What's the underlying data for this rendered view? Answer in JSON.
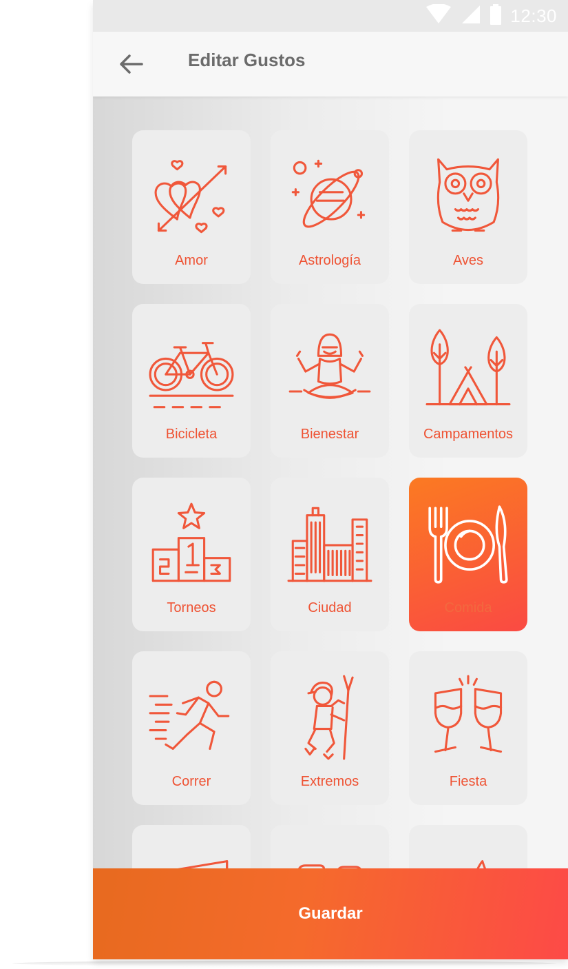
{
  "status_bar": {
    "time": "12:30",
    "icons": [
      "wifi-icon",
      "signal-icon",
      "battery-icon"
    ]
  },
  "header": {
    "title": "Editar Gustos",
    "back_icon": "arrow-left-icon"
  },
  "colors": {
    "accent": "#f0573a",
    "accent_gradient_start": "#fb7a22",
    "accent_gradient_end": "#fa4a43",
    "card_bg": "#ededed"
  },
  "interests": [
    {
      "label": "Amor",
      "icon": "hearts-arrow-icon",
      "selected": false
    },
    {
      "label": "Astrología",
      "icon": "planet-icon",
      "selected": false
    },
    {
      "label": "Aves",
      "icon": "owl-icon",
      "selected": false
    },
    {
      "label": "Bicicleta",
      "icon": "bicycle-icon",
      "selected": false
    },
    {
      "label": "Bienestar",
      "icon": "meditation-icon",
      "selected": false
    },
    {
      "label": "Campamentos",
      "icon": "tent-trees-icon",
      "selected": false
    },
    {
      "label": "Torneos",
      "icon": "podium-icon",
      "selected": false
    },
    {
      "label": "Ciudad",
      "icon": "city-buildings-icon",
      "selected": false
    },
    {
      "label": "Comida",
      "icon": "plate-cutlery-icon",
      "selected": true
    },
    {
      "label": "Correr",
      "icon": "runner-icon",
      "selected": false
    },
    {
      "label": "Extremos",
      "icon": "climber-icon",
      "selected": false
    },
    {
      "label": "Fiesta",
      "icon": "toast-glasses-icon",
      "selected": false
    },
    {
      "label": "",
      "icon": "music-icon",
      "selected": false
    },
    {
      "label": "",
      "icon": "camera-icon",
      "selected": false
    },
    {
      "label": "",
      "icon": "sailboat-icon",
      "selected": false
    }
  ],
  "footer": {
    "save_label": "Guardar"
  }
}
